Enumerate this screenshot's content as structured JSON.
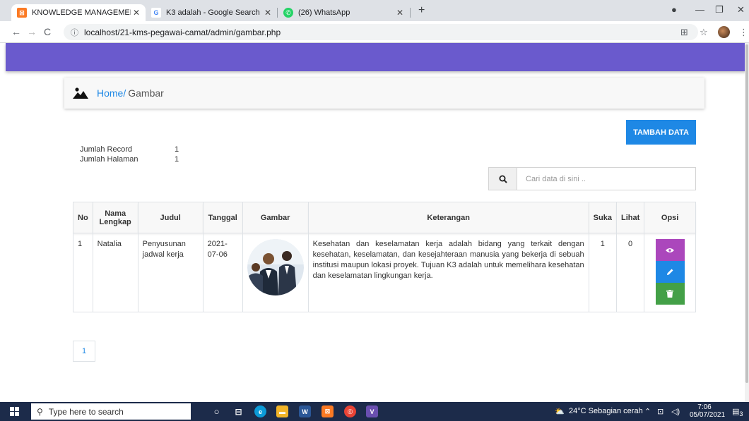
{
  "browser": {
    "tabs": [
      {
        "title": "KNOWLEDGE MANAGEMENT SYSTEM",
        "favicon": "xampp-icon",
        "active": true
      },
      {
        "title": "K3 adalah - Google Search",
        "favicon": "google-icon",
        "active": false
      },
      {
        "title": "(26) WhatsApp",
        "favicon": "whatsapp-icon",
        "active": false
      }
    ],
    "url": "localhost/21-kms-pegawai-camat/admin/gambar.php"
  },
  "breadcrumb": {
    "home": "Home",
    "separator": "/",
    "current": "Gambar"
  },
  "actions": {
    "add_label": "TAMBAH DATA"
  },
  "summary": {
    "record_label": "Jumlah Record",
    "record_value": "1",
    "page_label": "Jumlah Halaman",
    "page_value": "1"
  },
  "search": {
    "placeholder": "Cari data di sini .."
  },
  "table": {
    "headers": [
      "No",
      "Nama Lengkap",
      "Judul",
      "Tanggal",
      "Gambar",
      "Keterangan",
      "Suka",
      "Lihat",
      "Opsi"
    ],
    "rows": [
      {
        "no": "1",
        "nama": "Natalia",
        "judul": "Penyusunan jadwal kerja",
        "tanggal": "2021-07-06",
        "keterangan": "Kesehatan dan keselamatan kerja adalah bidang yang terkait dengan kesehatan, keselamatan, dan kesejahteraan manusia yang bekerja di sebuah institusi maupun lokasi proyek. Tujuan K3 adalah untuk memelihara kesehatan dan keselamatan lingkungan kerja.",
        "suka": "1",
        "lihat": "0"
      }
    ]
  },
  "pagination": {
    "pages": [
      "1"
    ]
  },
  "taskbar": {
    "search_placeholder": "Type here to search",
    "weather": "24°C  Sebagian cerah",
    "time": "7:06",
    "date": "05/07/2021",
    "notification_count": "3"
  },
  "colors": {
    "header": "#6a5acd",
    "primary": "#1e88e5",
    "view": "#ab47bc",
    "delete": "#43a047"
  }
}
